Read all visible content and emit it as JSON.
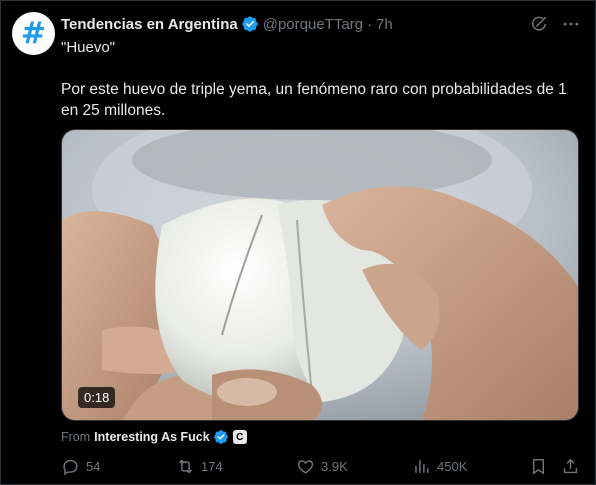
{
  "author": {
    "name": "Tendencias en Argentina",
    "handle": "@porqueTTarg",
    "time": "7h",
    "avatar_icon": "hashtag-icon"
  },
  "tweet": {
    "title_quote": "\"Huevo\"",
    "text": "Por este huevo de triple yema, un fenómeno raro con probabilidades de 1 en 25 millones."
  },
  "media": {
    "duration": "0:18",
    "from_prefix": "From",
    "source_name": "Interesting As Fuck",
    "source_badge": "C"
  },
  "actions": {
    "replies": "54",
    "retweets": "174",
    "likes": "3.9K",
    "views": "450K"
  },
  "colors": {
    "background": "#000000",
    "text": "#e7e9ea",
    "muted": "#71767b",
    "verified": "#1d9bf0"
  }
}
